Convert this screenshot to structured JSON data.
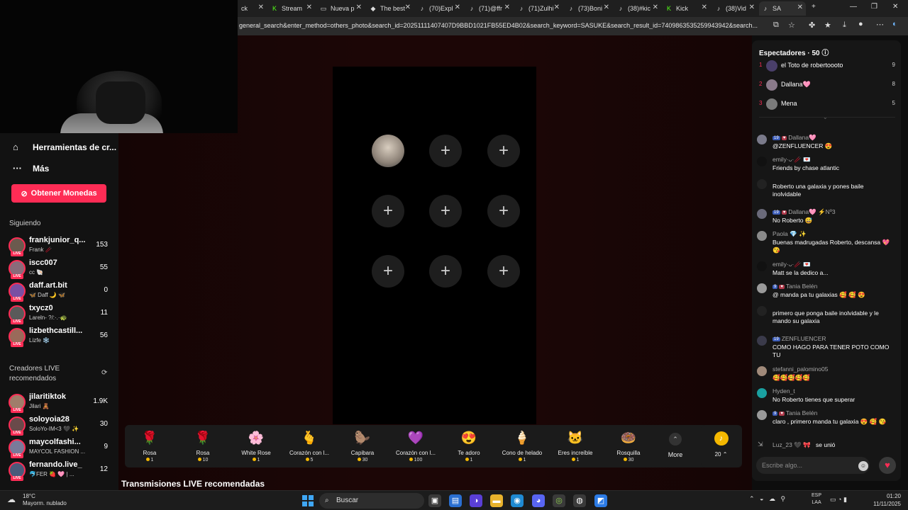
{
  "browser": {
    "tabs": [
      {
        "label": "ck",
        "icon": "",
        "active": false
      },
      {
        "label": "Stream",
        "icon": "K",
        "active": false
      },
      {
        "label": "Nueva p",
        "icon": "▭",
        "active": false
      },
      {
        "label": "The best",
        "icon": "◆",
        "active": false
      },
      {
        "label": "(70)Expl",
        "icon": "♪",
        "active": false
      },
      {
        "label": "(71)@ffr",
        "icon": "♪",
        "active": false
      },
      {
        "label": "(71)Zulhi",
        "icon": "♪",
        "active": false
      },
      {
        "label": "(73)Boni",
        "icon": "♪",
        "active": false
      },
      {
        "label": "(38)#kic",
        "icon": "♪",
        "active": false
      },
      {
        "label": "Kick",
        "icon": "K",
        "active": false
      },
      {
        "label": "(38)Vid",
        "icon": "♪",
        "active": false
      },
      {
        "label": "SA",
        "icon": "♪",
        "active": true
      }
    ],
    "url": "general_search&enter_method=others_photo&search_id=20251111407407D9BBD1021FB55ED4B02&search_keyword=SASUKE&search_result_id=7409863535259943942&search...",
    "new_tab": "+",
    "window_controls": [
      "—",
      "❐",
      "✕"
    ]
  },
  "sidebar": {
    "links": [
      {
        "label": "Herramientas de cr...",
        "icon": "⌂"
      },
      {
        "label": "Más",
        "icon": "···"
      }
    ],
    "coins_button": "Obtener Monedas",
    "following_title": "Siguiendo",
    "following": [
      {
        "name": "frankjunior_q...",
        "sub": "Frank 🥢",
        "count": "153"
      },
      {
        "name": "iscc007",
        "sub": "cc 🐚",
        "count": "55"
      },
      {
        "name": "daff.art.bit",
        "sub": "🦋 Daff 🌙 🦋",
        "count": "0"
      },
      {
        "name": "txycz0",
        "sub": "Lareln- ?/:·.·🐢",
        "count": "11"
      },
      {
        "name": "lizbethcastill...",
        "sub": "Lizfe ❄️",
        "count": "56"
      }
    ],
    "creators_title": "Creadores LIVE recomendados",
    "creators": [
      {
        "name": "jilaritiktok",
        "sub": "Jilari 🧸",
        "count": "1.9K"
      },
      {
        "name": "soloyoia28",
        "sub": "SoloYo-IM<3 🖤 ✨",
        "count": "30"
      },
      {
        "name": "maycolfashi...",
        "sub": "MAYCOL FASHION ...",
        "count": "9"
      },
      {
        "name": "fernando.live_",
        "sub": "🐬FER 🍓 🩷 | ...",
        "count": "12"
      }
    ],
    "live_badge": "LIVE"
  },
  "stage": {
    "slots": [
      "host",
      "+",
      "+",
      "+",
      "+",
      "+",
      "+",
      "+",
      "+"
    ]
  },
  "gifts": [
    {
      "name": "Rosa",
      "price": "1",
      "icon": "🌹"
    },
    {
      "name": "Rosa",
      "price": "10",
      "icon": "🌹"
    },
    {
      "name": "White Rose",
      "price": "1",
      "icon": "🌸"
    },
    {
      "name": "Corazón con l...",
      "price": "5",
      "icon": "🫰"
    },
    {
      "name": "Capibara",
      "price": "30",
      "icon": "🦫"
    },
    {
      "name": "Corazón con l...",
      "price": "100",
      "icon": "💜"
    },
    {
      "name": "Te adoro",
      "price": "1",
      "icon": "😍"
    },
    {
      "name": "Cono de helado",
      "price": "1",
      "icon": "🍦"
    },
    {
      "name": "Eres increíble",
      "price": "1",
      "icon": "🐱"
    },
    {
      "name": "Rosquilla",
      "price": "30",
      "icon": "🍩"
    }
  ],
  "gift_more": {
    "label": "More",
    "icon": "⌃"
  },
  "coin_balance": {
    "value": "20 ⌃",
    "icon": "♪"
  },
  "recommended_title": "Transmisiones LIVE recomendadas",
  "chat": {
    "spectators_title": "Espectadores · 50 ⓘ",
    "top_viewers": [
      {
        "rank": "1",
        "name": "el Toto de robertoooto",
        "count": "9"
      },
      {
        "rank": "2",
        "name": "Dallana🩷",
        "count": "8"
      },
      {
        "rank": "3",
        "name": "Mena",
        "count": "5"
      }
    ],
    "collapse_icon": "⌄",
    "messages": [
      {
        "badges": [
          "19",
          "♥"
        ],
        "user": "Dallana🩷",
        "text": "@ZENFLUENCER 😍"
      },
      {
        "badges": [],
        "user": "emily·ᴗ·🥢 💌",
        "text": "Friends by chase atlantic"
      },
      {
        "badges": [],
        "user": "",
        "text": "Roberto una galaxia y pones baile inolvidable"
      },
      {
        "badges": [
          "19",
          "♥"
        ],
        "user": "Dallana🩷 ⚡Nº3",
        "text": "No Roberto 😅"
      },
      {
        "badges": [],
        "user": "Paola 💎 ✨",
        "text": "Buenas madrugadas Roberto, descansa 💖 😘"
      },
      {
        "badges": [],
        "user": "emily·ᴗ·🥢 💌",
        "text": "Matt se la dedico a..."
      },
      {
        "badges": [
          "9",
          "♥"
        ],
        "user": "Tania Belén",
        "text": "@ manda pa tu galaxias 🥰 🥰 😍"
      },
      {
        "badges": [],
        "user": "",
        "text": "primero que ponga baile inolvidable y le mando su galaxia"
      },
      {
        "badges": [
          "19"
        ],
        "user": "ZENFLUENCER",
        "text": "COMO HAGO PARA TENER POTO COMO TU"
      },
      {
        "badges": [],
        "user": "stefanni_palomino05",
        "text": "🥰🥰🥰🥰🥰"
      },
      {
        "badges": [],
        "user": "Hyden_t",
        "text": "No Roberto tienes que superar"
      },
      {
        "badges": [
          "9",
          "♥"
        ],
        "user": "Tania Belén",
        "text": "claro , primero manda tu galaxia 😍 🥰 😘"
      }
    ],
    "join": {
      "user": "Luz_23 🖤 🎀",
      "text": "se unió"
    },
    "input_placeholder": "Escribe algo...",
    "emoji_icon": "☺",
    "heart_icon": "♥"
  },
  "taskbar": {
    "weather_temp": "18°C",
    "weather_desc": "Mayorm. nublado",
    "search_label": "Buscar",
    "lang_1": "ESP",
    "lang_2": "LAA",
    "time": "01:20",
    "date": "11/11/2025"
  },
  "colors": {
    "accent": "#fe2c55",
    "coin": "#f5b800",
    "background": "#0d0d0d"
  }
}
